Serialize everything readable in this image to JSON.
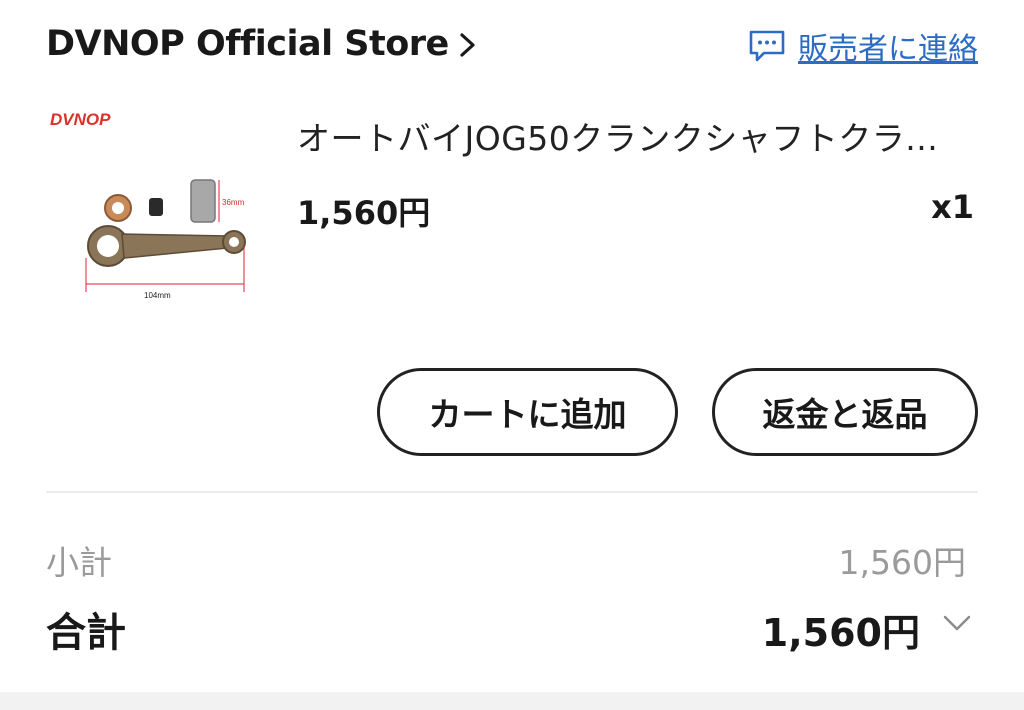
{
  "store": {
    "name": "DVNOP Official Store",
    "contact_label": "販売者に連絡",
    "link_color": "#2b6cc4"
  },
  "product": {
    "brand_logo_text": "DVNOP",
    "title": "オートバイJOG50クランクシャフトクラ...",
    "price": "1,560円",
    "quantity": "x1",
    "image_dimensions": [
      "36mm",
      "104mm"
    ]
  },
  "actions": {
    "add_to_cart": "カートに追加",
    "refund_return": "返金と返品"
  },
  "summary": {
    "subtotal_label": "小計",
    "subtotal_value": "1,560円",
    "total_label": "合計",
    "total_value": "1,560円"
  }
}
